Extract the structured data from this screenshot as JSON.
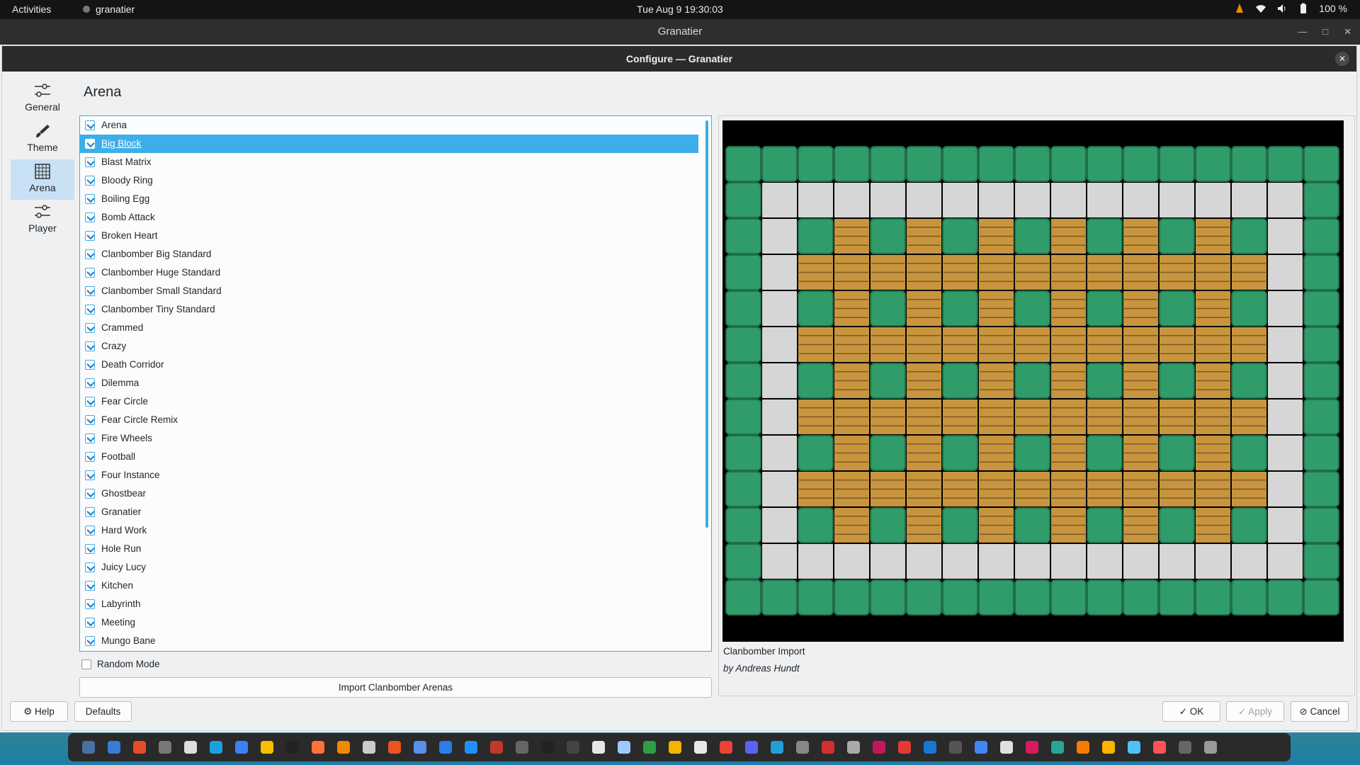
{
  "topbar": {
    "activities": "Activities",
    "app_name": "granatier",
    "clock": "Tue Aug 9  19:30:03",
    "battery": "100 %"
  },
  "window": {
    "title": "Granatier"
  },
  "dialog": {
    "title": "Configure — Granatier",
    "page_title": "Arena",
    "nav": [
      {
        "label": "General",
        "icon": "sliders-icon"
      },
      {
        "label": "Theme",
        "icon": "brush-icon"
      },
      {
        "label": "Arena",
        "icon": "grid-icon"
      },
      {
        "label": "Player",
        "icon": "sliders-icon"
      }
    ],
    "arenas": [
      "Arena",
      "Big Block",
      "Blast Matrix",
      "Bloody Ring",
      "Boiling Egg",
      "Bomb Attack",
      "Broken Heart",
      "Clanbomber Big Standard",
      "Clanbomber Huge Standard",
      "Clanbomber Small Standard",
      "Clanbomber Tiny Standard",
      "Crammed",
      "Crazy",
      "Death Corridor",
      "Dilemma",
      "Fear Circle",
      "Fear Circle Remix",
      "Fire Wheels",
      "Football",
      "Four Instance",
      "Ghostbear",
      "Granatier",
      "Hard Work",
      "Hole Run",
      "Juicy Lucy",
      "Kitchen",
      "Labyrinth",
      "Meeting",
      "Mungo Bane"
    ],
    "selected_index": 1,
    "random_mode": "Random Mode",
    "import_button": "Import Clanbomber Arenas",
    "preview_caption": "Clanbomber Import",
    "preview_author": "by Andreas Hundt",
    "buttons": {
      "help": "Help",
      "defaults": "Defaults",
      "ok": "OK",
      "apply": "Apply",
      "cancel": "Cancel"
    }
  },
  "colors": {
    "accent": "#3daee9",
    "wall": "#2f9c6a",
    "floor": "#d6d6d6",
    "brick": "#c8953e"
  }
}
